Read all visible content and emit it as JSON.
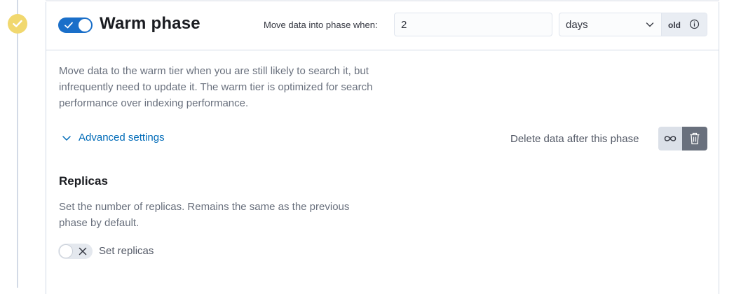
{
  "phase": {
    "title": "Warm phase",
    "enabled": true,
    "status_color": "#f1d86f",
    "accent_color": "#1a6fc9"
  },
  "timing": {
    "label": "Move data into phase when:",
    "value": "2",
    "unit": "days",
    "unit_options": [
      "days"
    ],
    "suffix": "old"
  },
  "description": "Move data to the warm tier when you are still likely to search it, but infrequently need to update it. The warm tier is optimized for search performance over indexing performance.",
  "advanced": {
    "label": "Advanced settings"
  },
  "delete": {
    "label": "Delete data after this phase",
    "infinity_icon": "infinity-icon",
    "trash_icon": "trash-icon"
  },
  "replicas": {
    "title": "Replicas",
    "description": "Set the number of replicas. Remains the same as the previous phase by default.",
    "toggle_label": "Set replicas",
    "enabled": false
  }
}
